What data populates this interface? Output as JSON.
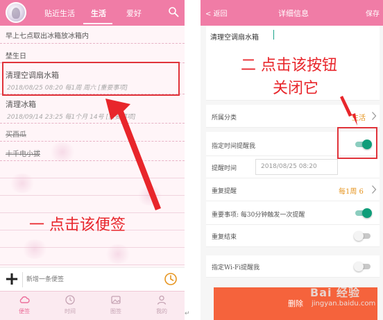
{
  "left": {
    "header": {
      "tabs": [
        "贴近生活",
        "生活",
        "爱好"
      ],
      "active_tab": "生活"
    },
    "notes": [
      {
        "title": "早上七点取出冰箱放冰箱内",
        "meta": "",
        "strike": false
      },
      {
        "title": "埜生日",
        "meta": "",
        "strike": false
      },
      {
        "title": "清理空调扇水箱",
        "meta": "2018/08/25 08:20  每1周   周六   [重要事项]",
        "strike": false
      },
      {
        "title": "清理冰箱",
        "meta": "2018/09/14 23:25  每1个月  14号  [重要事项]",
        "strike": false
      },
      {
        "title": "买西瓜",
        "meta": "",
        "strike": true
      },
      {
        "title": "十千电小拔",
        "meta": "",
        "strike": true
      }
    ],
    "annotation": "一 点击该便签",
    "input": {
      "placeholder": "新增一条便签"
    },
    "bottom_nav": [
      {
        "label": "便签",
        "icon": "cloud-icon"
      },
      {
        "label": "时间",
        "icon": "clock-icon"
      },
      {
        "label": "图签",
        "icon": "photo-icon"
      },
      {
        "label": "我的",
        "icon": "user-icon"
      }
    ]
  },
  "right": {
    "header": {
      "back": "< 返回",
      "title": "详细信息",
      "save": "保存"
    },
    "content": "清理空调扇水箱",
    "annotation_line1": "二 点击该按钮",
    "annotation_line2": "关闭它",
    "rows": {
      "category": {
        "label": "所属分类",
        "value": "生活"
      },
      "remind": {
        "label": "指定时间提醒我",
        "on": true
      },
      "time": {
        "label": "提醒时间",
        "value": "2018/08/25 08:20"
      },
      "repeat": {
        "label": "重复提醒",
        "value": "每1周 6"
      },
      "important": {
        "label": "重要事项: 每30分钟触发一次提醒",
        "on": true
      },
      "end": {
        "label": "重复结束",
        "on": false
      },
      "wifi": {
        "label": "指定Wi-Fi提醒我",
        "on": false
      }
    },
    "delete_label": "删除",
    "watermark": "Bai 经验",
    "watermark_url": "jingyan.baidu.com"
  },
  "page_mark": "↵",
  "colors": {
    "header_pink": "#f07ca6",
    "toggle_on": "#0f9d79",
    "annotation_red": "#e8262b",
    "delete_orange": "#f5633c",
    "value_orange": "#e69520"
  }
}
